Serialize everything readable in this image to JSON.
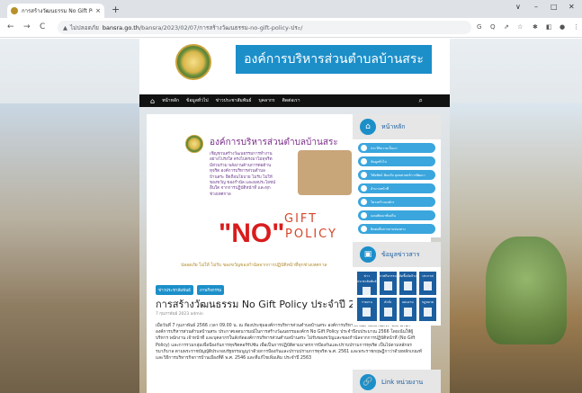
{
  "browser": {
    "tab_title": "การสร้างวัฒนธรรม No Gift Policy ป",
    "tab_close": "×",
    "new_tab": "+",
    "window_controls": [
      "∨",
      "–",
      "□",
      "✕"
    ],
    "nav": [
      "←",
      "→",
      "C"
    ],
    "url_warning": "▲",
    "url_insecure": "ไม่ปลอดภัย",
    "url_domain": "bansra.go.th",
    "url_path": "/bansra/2023/02/07/การสร้างวัฒนธรรม-no-gift-policy-ประ/",
    "toolbar_icons": [
      "G",
      "Q",
      "⇗",
      "☆",
      "✱",
      "◧",
      "●",
      "⋮"
    ]
  },
  "site": {
    "brand": "องค์การบริหารส่วนตำบลบ้านสระ",
    "menu_home_icon": "⌂",
    "menu": [
      "หน้าหลัก",
      "ข้อมูลทั่วไป",
      "ข่าวประชาสัมพันธ์",
      "บุคลากร",
      "ติดต่อเรา"
    ],
    "search_icon": "⌕"
  },
  "poster": {
    "title": "องค์การบริหารส่วนตำบลบ้านสระ",
    "text": "เชิญชวนสร้างวัฒนธรรมการทำงาน\nอย่างโปร่งใส ตรงไปตรงมาไม่ทุจริต\nมีส่วนร่วม พลังงานด้านการต่อต้าน\nทุจริต องค์การบริหารส่วนตำบล\nบ้านสระ ยึดถือนโยบาย ไม่รับ ไม่ให้\nของขวัญ ของกำนัล และผลประโยชน์\nอื่นใด จากการปฏิบัติหน้าที่ และทุก\nช่วงเทศกาล",
    "no": "\"NO\"",
    "gift": "GIFT",
    "policy": "POLICY",
    "footer": "ปลอดภัย ไม่ให้ ไม่รับ ของขวัญของกำนัลจากการปฏิบัติหน้าที่ทุกช่วงเทศกาล"
  },
  "article": {
    "tags": [
      "ข่าวประชาสัมพันธ์",
      "ภาพกิจกรรม"
    ],
    "headline": "การสร้างวัฒนธรรม No Gift Policy ประจำปี 2566",
    "meta": "7 กุมภาพันธ์ 2023   admin",
    "body": "เมื่อวันที่ 7 กุมภาพันธ์ 2566 เวลา 09.00 น. ณ ห้องประชุมองค์การบริหารส่วนตำบลบ้านสระ องค์การบริหารส่วนตำบลบ้านสระ โดย นายกองค์การบริหารส่วนตำบลบ้านสระ ประกาศเจตนารมณ์ในการสร้างวัฒนธรรมองค์กร No Gift Policy ประจำปีงบประมาณ 2566 โดยเน้นให้ผู้บริหาร พนักงาน เจ้าหน้าที่ และบุคลากรในสังกัดองค์การบริหารส่วนตำบลบ้านสระ ไม่รับของขวัญและของกำนัลจากการปฏิบัติหน้าที่ (No Gift Policy) และการรวมกลุ่มเพื่อป้องกันการทุจริตคอร์รัปชัน เพื่อเป็นการปฏิบัติตามมาตรการป้องกันและปราบปรามการทุจริต เป็นไปตามหลักธรรมาภิบาล ตามพระราชบัญญัติประกอบรัฐธรรมนูญว่าด้วยการป้องกันและปราบปรามการทุจริต พ.ศ. 2561 และพระราชกฤษฎีกาว่าด้วยหลักเกณฑ์และวิธีการบริหารกิจการบ้านเมืองที่ดี พ.ศ. 2546 และที่แก้ไขเพิ่มเติม ประจำปี 2563"
  },
  "sidebar": {
    "home_icon": "⌂",
    "home_title": "หน้าหลัก",
    "links": [
      "ประวัติความเป็นมา",
      "ข้อมูลทั่วไป",
      "วิสัยทัศน์ พันธกิจ ยุทธศาสตร์การพัฒนา",
      "อำนาจหน้าที่",
      "โครงสร้างองค์กร",
      "แผนพัฒนาท้องถิ่น",
      "ติดต่อสื่อสารผ่านช่องทาง"
    ],
    "news_icon": "▣",
    "news_title": "ข้อมูลข่าวสาร",
    "news_grid": [
      "ข่าวประชาสัมพันธ์",
      "ภาพกิจกรรม",
      "จัดซื้อจัดจ้าง",
      "ประกาศ",
      "รายงาน",
      "คำสั่ง",
      "แผนงาน",
      "กฎหมาย"
    ],
    "link_icon": "🔗",
    "link_title": "Link หน่วยงาน"
  }
}
